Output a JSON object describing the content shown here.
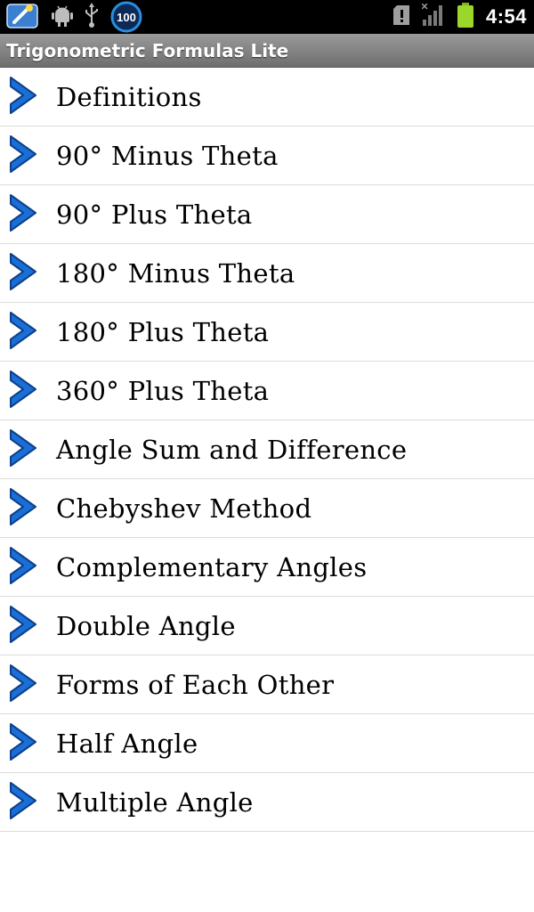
{
  "status_bar": {
    "icons": [
      "app-launcher-icon",
      "android-debug-icon",
      "usb-icon",
      "battery-percent-badge-icon",
      "sd-card-alert-icon",
      "signal-strength-icon",
      "battery-icon"
    ],
    "badge_text": "100",
    "time": "4:54"
  },
  "app": {
    "title": "Trigonometric Formulas Lite"
  },
  "menu": {
    "icon": "chevron-right-icon",
    "items": [
      {
        "label": "Definitions"
      },
      {
        "label": "90° Minus Theta"
      },
      {
        "label": "90° Plus Theta"
      },
      {
        "label": "180° Minus Theta"
      },
      {
        "label": "180° Plus Theta"
      },
      {
        "label": "360° Plus Theta"
      },
      {
        "label": "Angle Sum and Difference"
      },
      {
        "label": "Chebyshev Method"
      },
      {
        "label": "Complementary Angles"
      },
      {
        "label": "Double Angle"
      },
      {
        "label": "Forms of Each Other"
      },
      {
        "label": "Half Angle"
      },
      {
        "label": "Multiple Angle"
      }
    ]
  },
  "colors": {
    "chevron": "#1a6fd6",
    "title_bar": "#7f7f7f",
    "battery": "#9bd62a",
    "badge_ring": "#2a8de0"
  }
}
